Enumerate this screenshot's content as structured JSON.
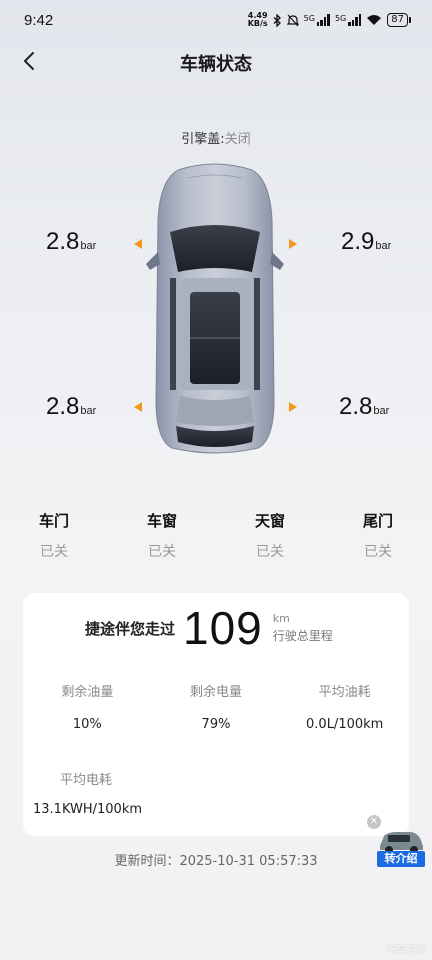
{
  "status": {
    "time": "9:42",
    "net_speed_top": "4.49",
    "net_speed_bottom": "KB/s",
    "sig1": "5G",
    "sig2": "5G",
    "battery": "87"
  },
  "nav": {
    "title": "车辆状态"
  },
  "hood": {
    "label": "引擎盖:",
    "value": "关闭"
  },
  "tires": {
    "front_left": {
      "value": "2.8",
      "unit": "bar"
    },
    "front_right": {
      "value": "2.9",
      "unit": "bar"
    },
    "rear_left": {
      "value": "2.8",
      "unit": "bar"
    },
    "rear_right": {
      "value": "2.8",
      "unit": "bar"
    }
  },
  "states": [
    {
      "name": "车门",
      "value": "已关"
    },
    {
      "name": "车窗",
      "value": "已关"
    },
    {
      "name": "天窗",
      "value": "已关"
    },
    {
      "name": "尾门",
      "value": "已关"
    }
  ],
  "card": {
    "mileage_label": "捷途伴您走过",
    "mileage_value": "109",
    "mileage_unit": "km",
    "mileage_desc": "行驶总里程",
    "metrics": [
      {
        "label": "剩余油量",
        "value": "10%"
      },
      {
        "label": "剩余电量",
        "value": "79%"
      },
      {
        "label": "平均油耗",
        "value": "0.0L/100km"
      }
    ],
    "avg_power": {
      "label": "平均电耗",
      "value": "13.1KWH/100km"
    }
  },
  "promo": {
    "label": "转介绍"
  },
  "update": {
    "label": "更新时间：",
    "value": "2025-10-31 05:57:33"
  },
  "watermark": "汽车之家",
  "colors": {
    "accent_arrow": "#f29a1e",
    "promo_blue": "#1d6be3"
  }
}
